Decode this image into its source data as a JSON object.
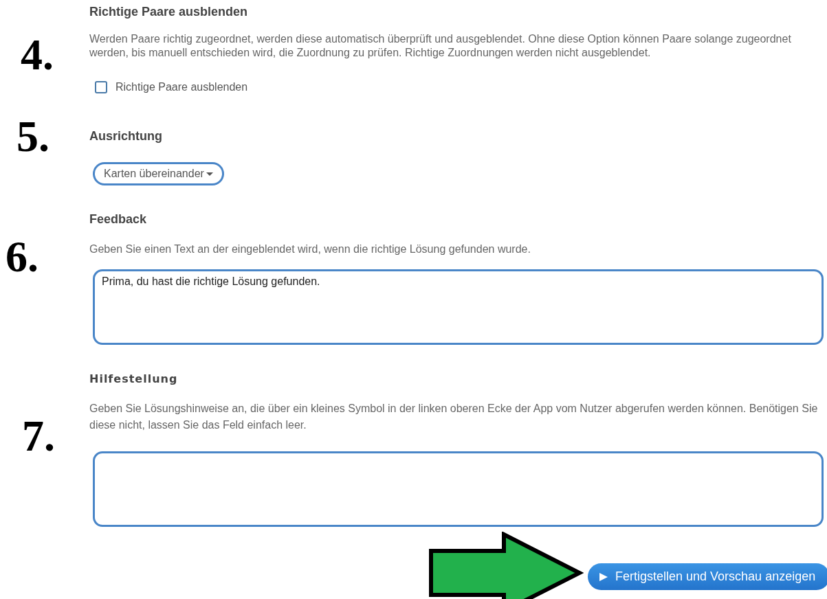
{
  "sections": [
    {
      "step": "4.",
      "heading": "Richtige Paare ausblenden",
      "description": "Werden Paare richtig zugeordnet, werden diese automatisch überprüft und ausgeblendet. Ohne diese Option können Paare solange zugeordnet werden, bis manuell entschieden wird, die Zuordnung zu prüfen. Richtige Zuordnungen werden nicht ausgeblendet.",
      "kind": "checkbox",
      "checkbox": {
        "label": "Richtige Paare ausblenden",
        "checked": false
      }
    },
    {
      "step": "5.",
      "heading": "Ausrichtung",
      "kind": "dropdown",
      "dropdown": {
        "value": "Karten übereinander"
      }
    },
    {
      "step": "6.",
      "heading": "Feedback",
      "description": "Geben Sie einen Text an der eingeblendet wird, wenn die richtige Lösung gefunden wurde.",
      "kind": "textarea",
      "textarea": {
        "value": "Prima, du hast die richtige Lösung gefunden."
      }
    },
    {
      "step": "7.",
      "heading": "Hilfestellung",
      "description": "Geben Sie Lösungshinweise an, die über ein kleines Symbol in der linken oberen Ecke der App vom Nutzer abgerufen werden können. Benötigen Sie diese nicht, lassen Sie das Feld einfach leer.",
      "kind": "textarea"
    }
  ],
  "finish_button": {
    "label": "Fertigstellen und Vorschau anzeigen"
  }
}
